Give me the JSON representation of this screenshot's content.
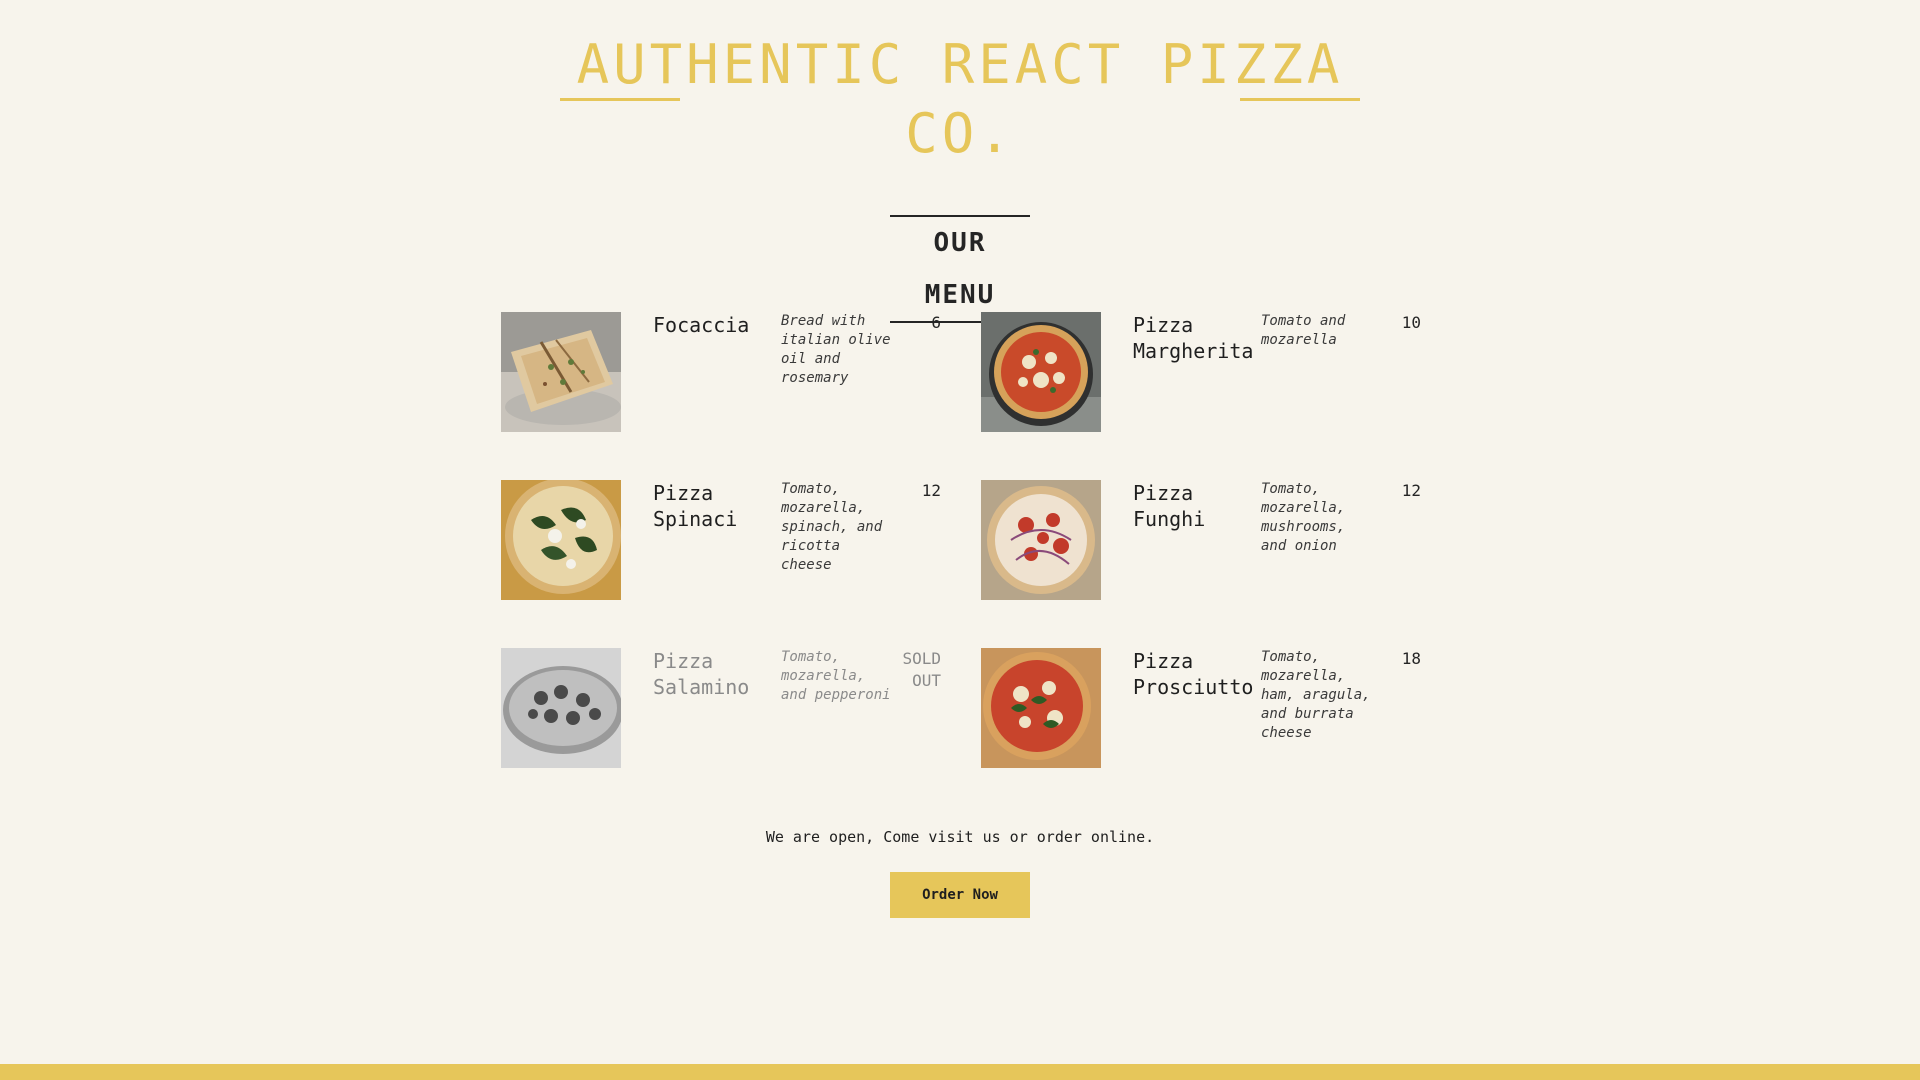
{
  "header": {
    "title": "Authentic React Pizza Co.",
    "accent_color": "#e6c65a"
  },
  "menu": {
    "heading": "OUR MENU",
    "items": [
      {
        "name": "Focaccia",
        "description": "Bread with italian olive oil and rosemary",
        "price": "6",
        "sold_out": false,
        "image_icon": "focaccia-image"
      },
      {
        "name": "Pizza Margherita",
        "description": "Tomato and mozarella",
        "price": "10",
        "sold_out": false,
        "image_icon": "pizza-margherita-image"
      },
      {
        "name": "Pizza Spinaci",
        "description": "Tomato, mozarella, spinach, and ricotta cheese",
        "price": "12",
        "sold_out": false,
        "image_icon": "pizza-spinaci-image"
      },
      {
        "name": "Pizza Funghi",
        "description": "Tomato, mozarella, mushrooms, and onion",
        "price": "12",
        "sold_out": false,
        "image_icon": "pizza-funghi-image"
      },
      {
        "name": "Pizza Salamino",
        "description": "Tomato, mozarella, and pepperoni",
        "price": "SOLD OUT",
        "sold_out": true,
        "image_icon": "pizza-salamino-image"
      },
      {
        "name": "Pizza Prosciutto",
        "description": "Tomato, mozarella, ham, aragula, and burrata cheese",
        "price": "18",
        "sold_out": false,
        "image_icon": "pizza-prosciutto-image"
      }
    ]
  },
  "footer": {
    "message": "We are open, Come visit us or order online.",
    "order_button_label": "Order Now"
  }
}
